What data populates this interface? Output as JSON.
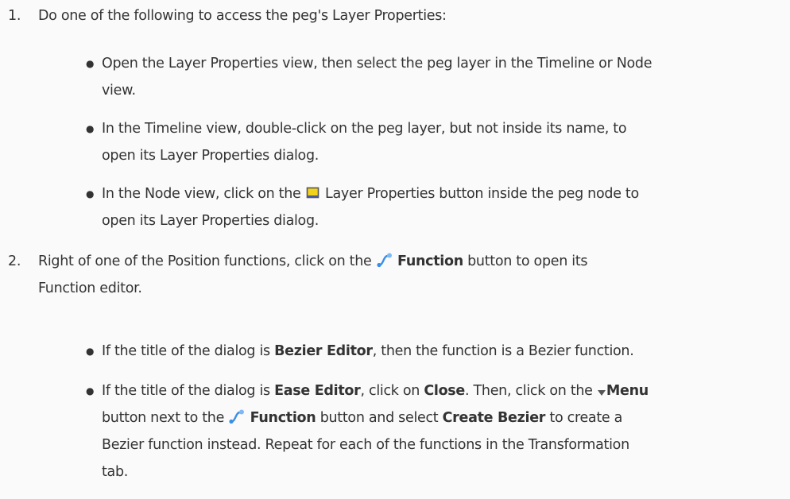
{
  "steps": [
    {
      "number": "1.",
      "text": "Do one of the following to access the peg's Layer Properties:",
      "bullets": [
        {
          "line1": "Open the Layer Properties view, then select the peg layer in the Timeline or Node",
          "line2": "view."
        },
        {
          "line1": "In the Timeline view, double-click on the peg layer, but not inside its name, to",
          "line2": "open its Layer Properties dialog."
        },
        {
          "line1_pre": "In the Node view, click on the",
          "line1_post": "Layer Properties button inside the peg node to",
          "line2": "open its Layer Properties dialog.",
          "icon": "layer-properties-icon"
        }
      ]
    },
    {
      "number": "2.",
      "line1_pre": "Right of one of the Position functions, click on the",
      "line1_bold": "Function",
      "line1_post": "button to open its",
      "line2": "Function editor.",
      "icon": "function-icon",
      "bullets": [
        {
          "pre": "If the title of the dialog is",
          "bold": "Bezier Editor",
          "post": ", then the function is a Bezier function."
        },
        {
          "l1_a": "If the title of the dialog is",
          "l1_b": "Ease Editor",
          "l1_c": ", click on",
          "l1_d": "Close",
          "l1_e": ". Then, click on the",
          "l1_f": "Menu",
          "l2_a": "button next to the",
          "l2_b": "Function",
          "l2_c": "button and select",
          "l2_d": "Create Bezier",
          "l2_e": "to create a",
          "l3": "Bezier function instead. Repeat for each of the functions in the Transformation",
          "l4": "tab.",
          "menu_icon": "triangle-down-icon",
          "func_icon": "function-icon"
        }
      ]
    }
  ],
  "colors": {
    "text": "#333333",
    "background": "#fafafa",
    "layer_icon_fill": "#f3d21b",
    "function_icon": "#3a8ee6"
  }
}
